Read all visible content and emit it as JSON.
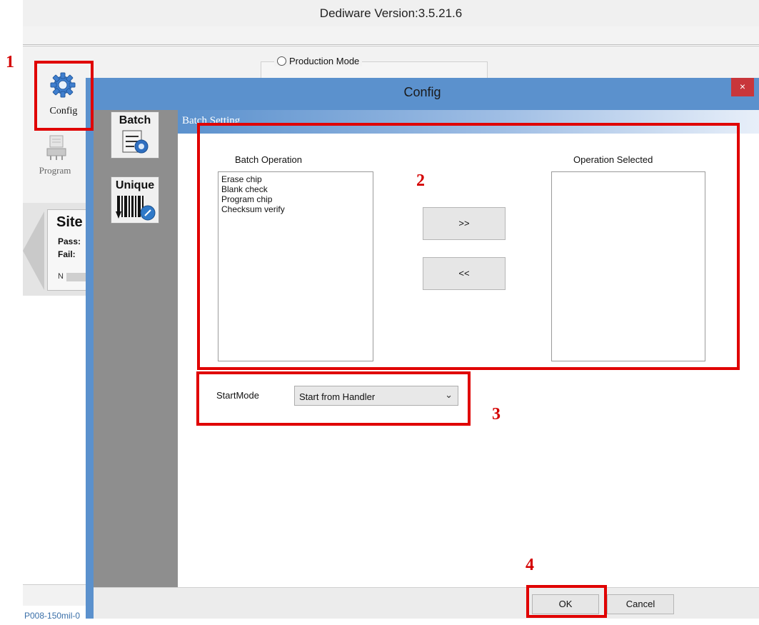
{
  "app": {
    "title": "Dediware Version:3.5.21.6",
    "production_mode_label": "Production Mode",
    "toolbar": {
      "config_label": "Config",
      "program_label": "Program"
    },
    "site_panel": {
      "title": "Site",
      "pass_label": "Pass:",
      "fail_label": "Fail:",
      "n_label": "N"
    },
    "status_text": "P008-150mil-0"
  },
  "dialog": {
    "title": "Config",
    "close_label": "×",
    "sidebar": {
      "batch_label": "Batch",
      "unique_label": "Unique"
    },
    "section_title": "Batch Setting",
    "batch_operation_header": "Batch Operation",
    "operation_selected_header": "Operation Selected",
    "batch_operations": [
      "Erase chip",
      "Blank check",
      "Program chip",
      "Checksum verify"
    ],
    "operations_selected": [],
    "add_button": ">>",
    "remove_button": "<<",
    "start_mode_label": "StartMode",
    "start_mode_value": "Start from Handler",
    "ok_label": "OK",
    "cancel_label": "Cancel"
  },
  "annotations": {
    "step1": "1",
    "step2": "2",
    "step3": "3",
    "step4": "4",
    "color": "#e00000"
  },
  "colors": {
    "dialog_frame": "#5b91cd",
    "sidebar": "#8e8e8e",
    "close_button": "#c8363b"
  }
}
